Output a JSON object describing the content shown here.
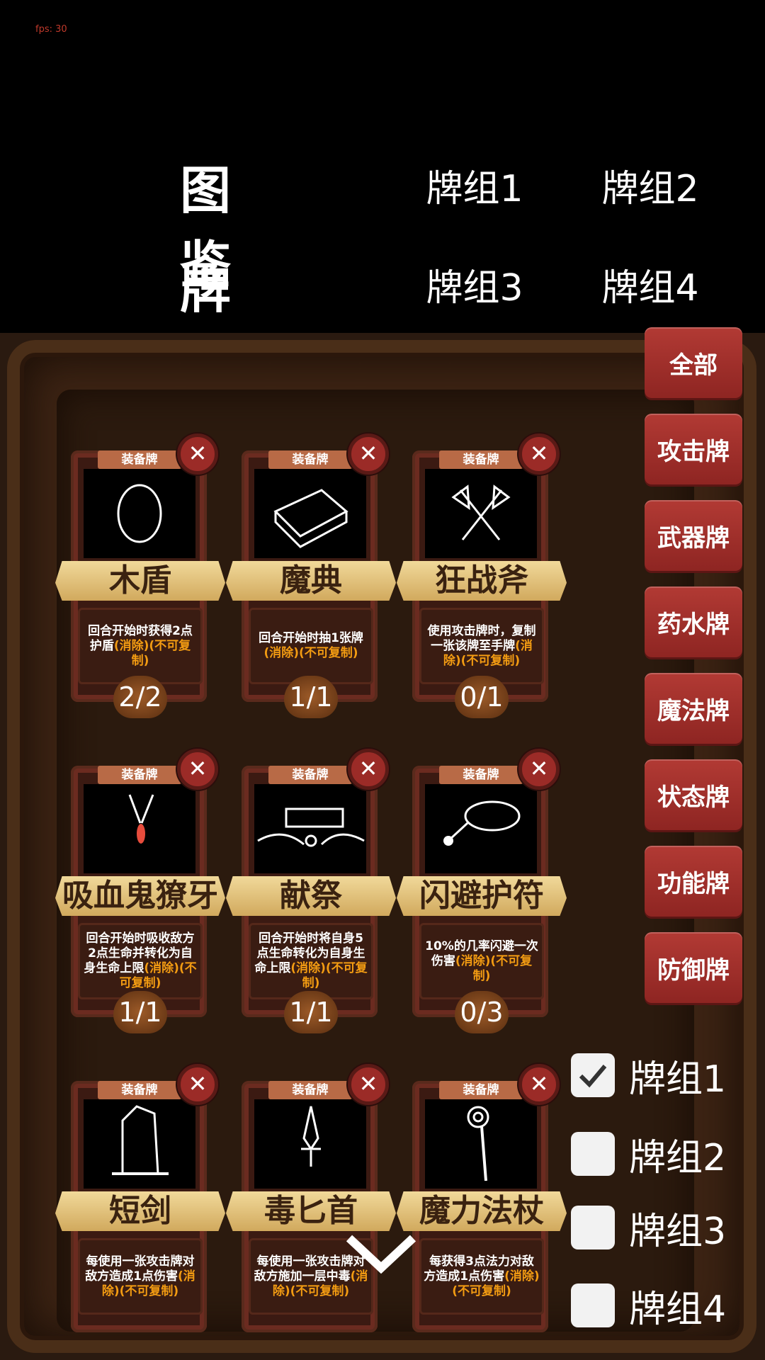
{
  "fps": "fps: 30",
  "tabs": {
    "collection": "图鉴",
    "library": "牌库",
    "deck1": "牌组1",
    "deck2": "牌组2",
    "deck3": "牌组3",
    "deck4": "牌组4"
  },
  "filters": [
    "全部",
    "攻击牌",
    "武器牌",
    "药水牌",
    "魔法牌",
    "状态牌",
    "功能牌",
    "防御牌"
  ],
  "cards": [
    {
      "type": "装备牌",
      "name": "木盾",
      "desc": "回合开始时获得2点护盾",
      "tag": "(消除)(不可复制)",
      "count": "2/2",
      "icon": "shield-icon"
    },
    {
      "type": "装备牌",
      "name": "魔典",
      "desc": "回合开始时抽1张牌",
      "tag": "(消除)(不可复制)",
      "count": "1/1",
      "icon": "book-icon"
    },
    {
      "type": "装备牌",
      "name": "狂战斧",
      "desc": "使用攻击牌时，复制一张该牌至手牌",
      "tag": "(消除)(不可复制)",
      "count": "0/1",
      "icon": "axes-icon"
    },
    {
      "type": "装备牌",
      "name": "吸血鬼獠牙",
      "desc": "回合开始时吸收敌方2点生命并转化为自身生命上限",
      "tag": "(消除)(不可复制)",
      "count": "1/1",
      "icon": "fang-icon"
    },
    {
      "type": "装备牌",
      "name": "献祭",
      "desc": "回合开始时将自身5点生命转化为自身生命上限",
      "tag": "(消除)(不可复制)",
      "count": "1/1",
      "icon": "altar-icon"
    },
    {
      "type": "装备牌",
      "name": "闪避护符",
      "desc": "10%的几率闪避一次伤害",
      "tag": "(消除)(不可复制)",
      "count": "0/3",
      "icon": "amulet-icon"
    },
    {
      "type": "装备牌",
      "name": "短剑",
      "desc": "每使用一张攻击牌对敌方造成1点伤害",
      "tag": "(消除)(不可复制)",
      "count": "",
      "icon": "shortsword-icon"
    },
    {
      "type": "装备牌",
      "name": "毒匕首",
      "desc": "每使用一张攻击牌对敌方施加一层中毒",
      "tag": "(消除)(不可复制)",
      "count": "",
      "icon": "dagger-icon"
    },
    {
      "type": "装备牌",
      "name": "魔力法杖",
      "desc": "每获得3点法力对敌方造成1点伤害",
      "tag": "(消除)(不可复制)",
      "count": "",
      "icon": "staff-icon"
    }
  ],
  "close_glyph": "✕",
  "decks": [
    {
      "label": "牌组1",
      "checked": true
    },
    {
      "label": "牌组2",
      "checked": false
    },
    {
      "label": "牌组3",
      "checked": false
    },
    {
      "label": "牌组4",
      "checked": false
    }
  ]
}
